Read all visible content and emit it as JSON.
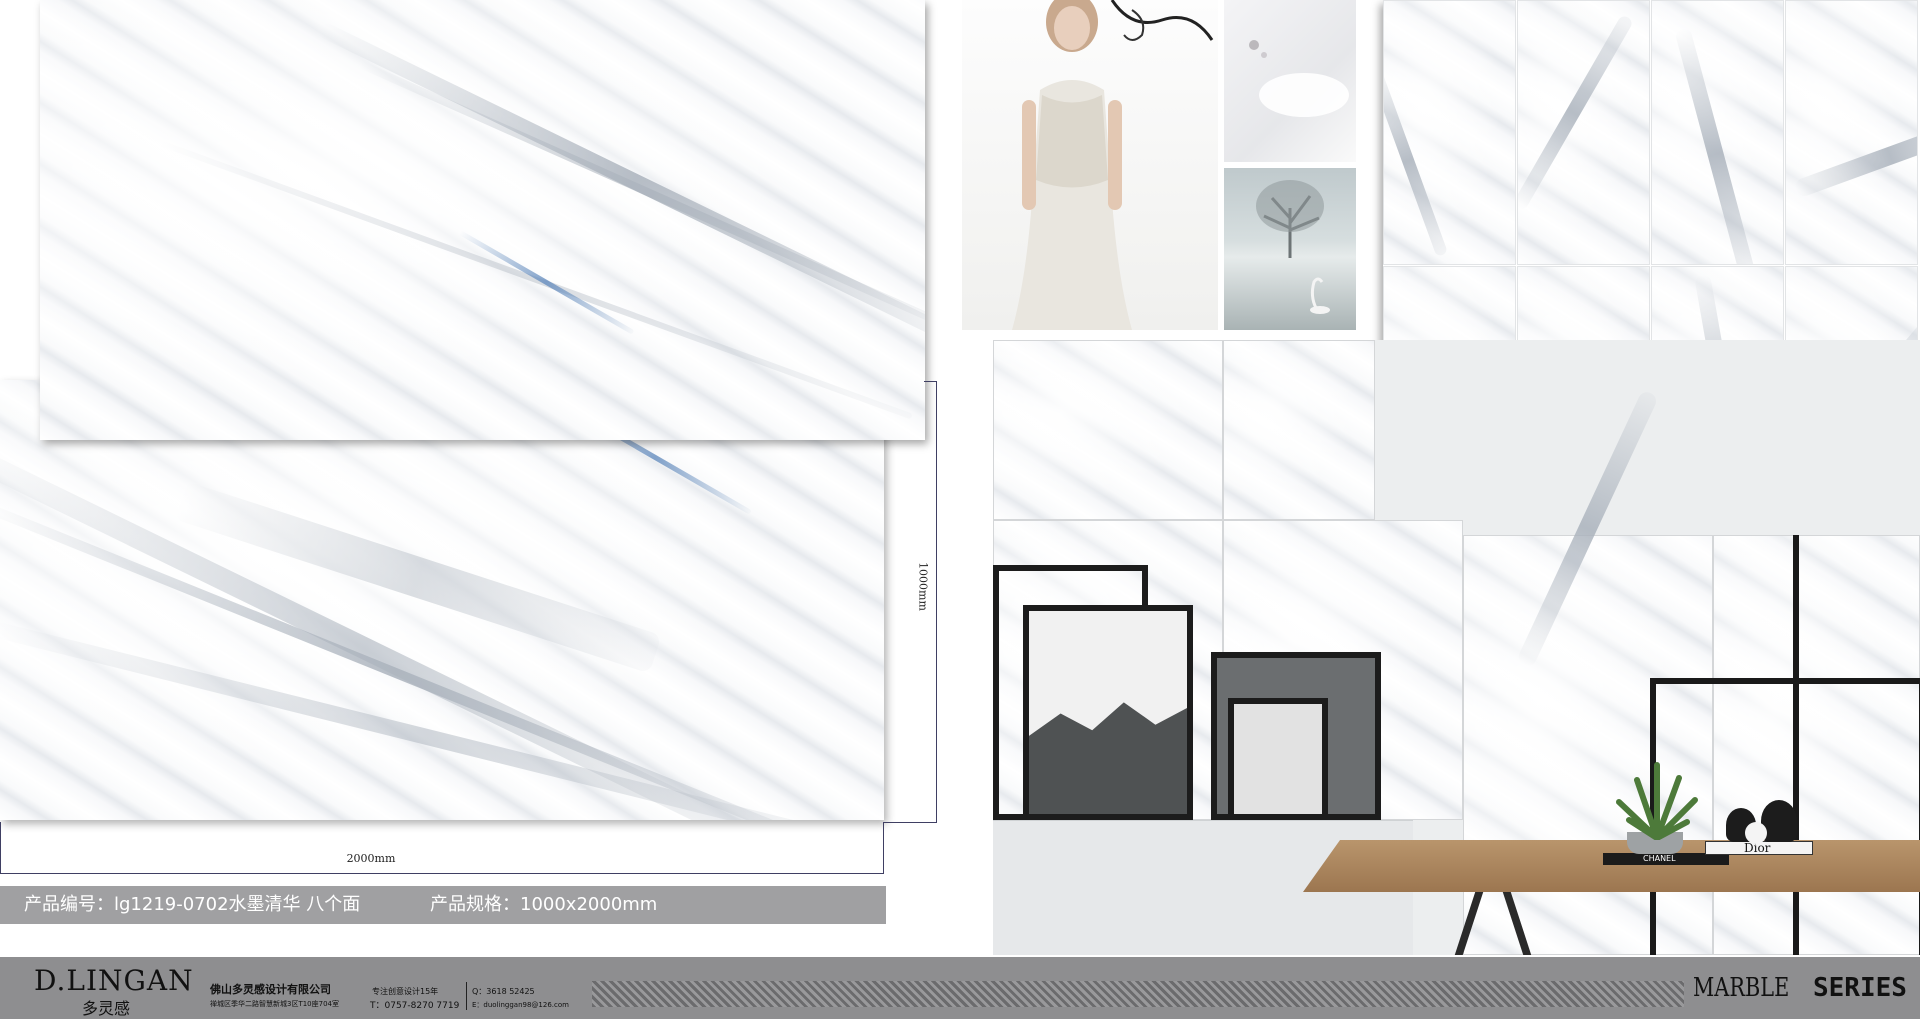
{
  "slabs": {
    "width_label": "2000mm",
    "height_label": "1000mm"
  },
  "product_info": {
    "code_text": "产品编号：lg1219-0702水墨清华 八个面",
    "spec_text": "产品规格：1000x2000mm"
  },
  "interior_props": {
    "book_top": "Dior",
    "book_bottom": "CHANEL"
  },
  "footer": {
    "logo_main": "D.LINGAN",
    "logo_sub": "多灵感",
    "company_name": "佛山多灵感设计有限公司",
    "address": "禅城区季华二路智慧新城3区T10座704室",
    "slogan": "专注创意设计15年",
    "phone": "T：0757-8270 7719",
    "qq": "Q：3618 52425",
    "email": "E：duolinggan98@126.com",
    "series_word1": "MARBLE",
    "series_word2": "SERIES"
  },
  "colors": {
    "footer_bg": "#8e8e90",
    "info_bar_bg": "#a0a0a2",
    "dimension_line": "#3f3f63"
  }
}
